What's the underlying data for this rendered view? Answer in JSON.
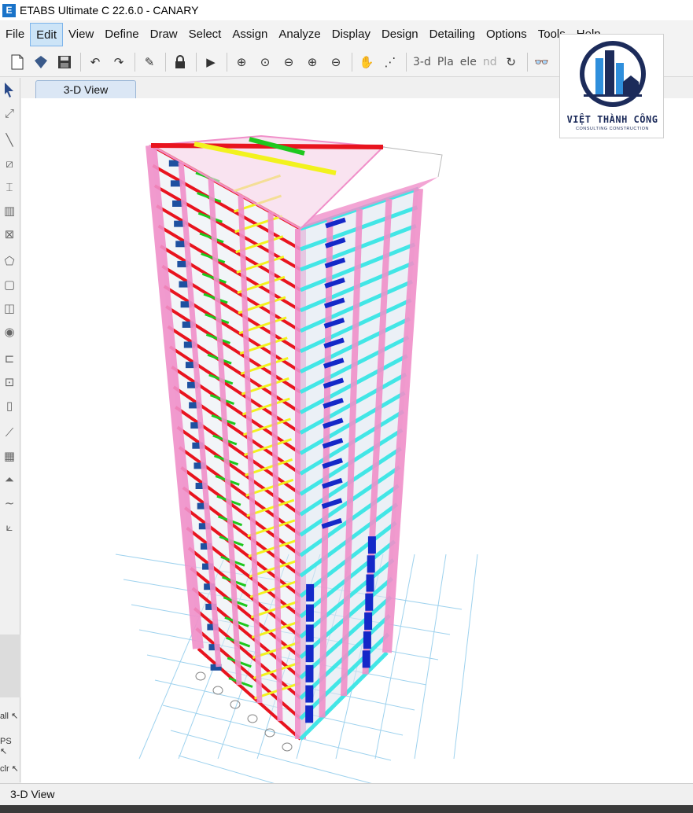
{
  "window": {
    "title": "ETABS Ultimate C 22.6.0 - CANARY",
    "app_icon_letter": "E"
  },
  "menu": {
    "items": [
      "File",
      "Edit",
      "View",
      "Define",
      "Draw",
      "Select",
      "Assign",
      "Analyze",
      "Display",
      "Design",
      "Detailing",
      "Options",
      "Tools",
      "Help"
    ],
    "active": "Edit"
  },
  "toolbar": {
    "view_3d_label": "3-d",
    "plan_label": "Pla",
    "elev_label": "ele",
    "nd_label": "nd"
  },
  "leftbar": {
    "all_label": "all",
    "ps_label": "PS",
    "clr_label": "clr"
  },
  "tab": {
    "label": "3-D View"
  },
  "status": {
    "text": "3-D View"
  },
  "logo": {
    "name": "VIỆT THÀNH CÔNG",
    "tagline": "CONSULTING CONSTRUCTION",
    "color": "#1c2b5a"
  },
  "model": {
    "stories": 25,
    "colors": {
      "column": "#f08fc9",
      "beam_red": "#e8141e",
      "beam_cyan": "#42e6e6",
      "beam_yellow": "#f2f21e",
      "beam_green": "#1ec81e",
      "wall_blue": "#1428c8",
      "stair": "#1e50a0",
      "grid": "#9ed2ee"
    }
  }
}
